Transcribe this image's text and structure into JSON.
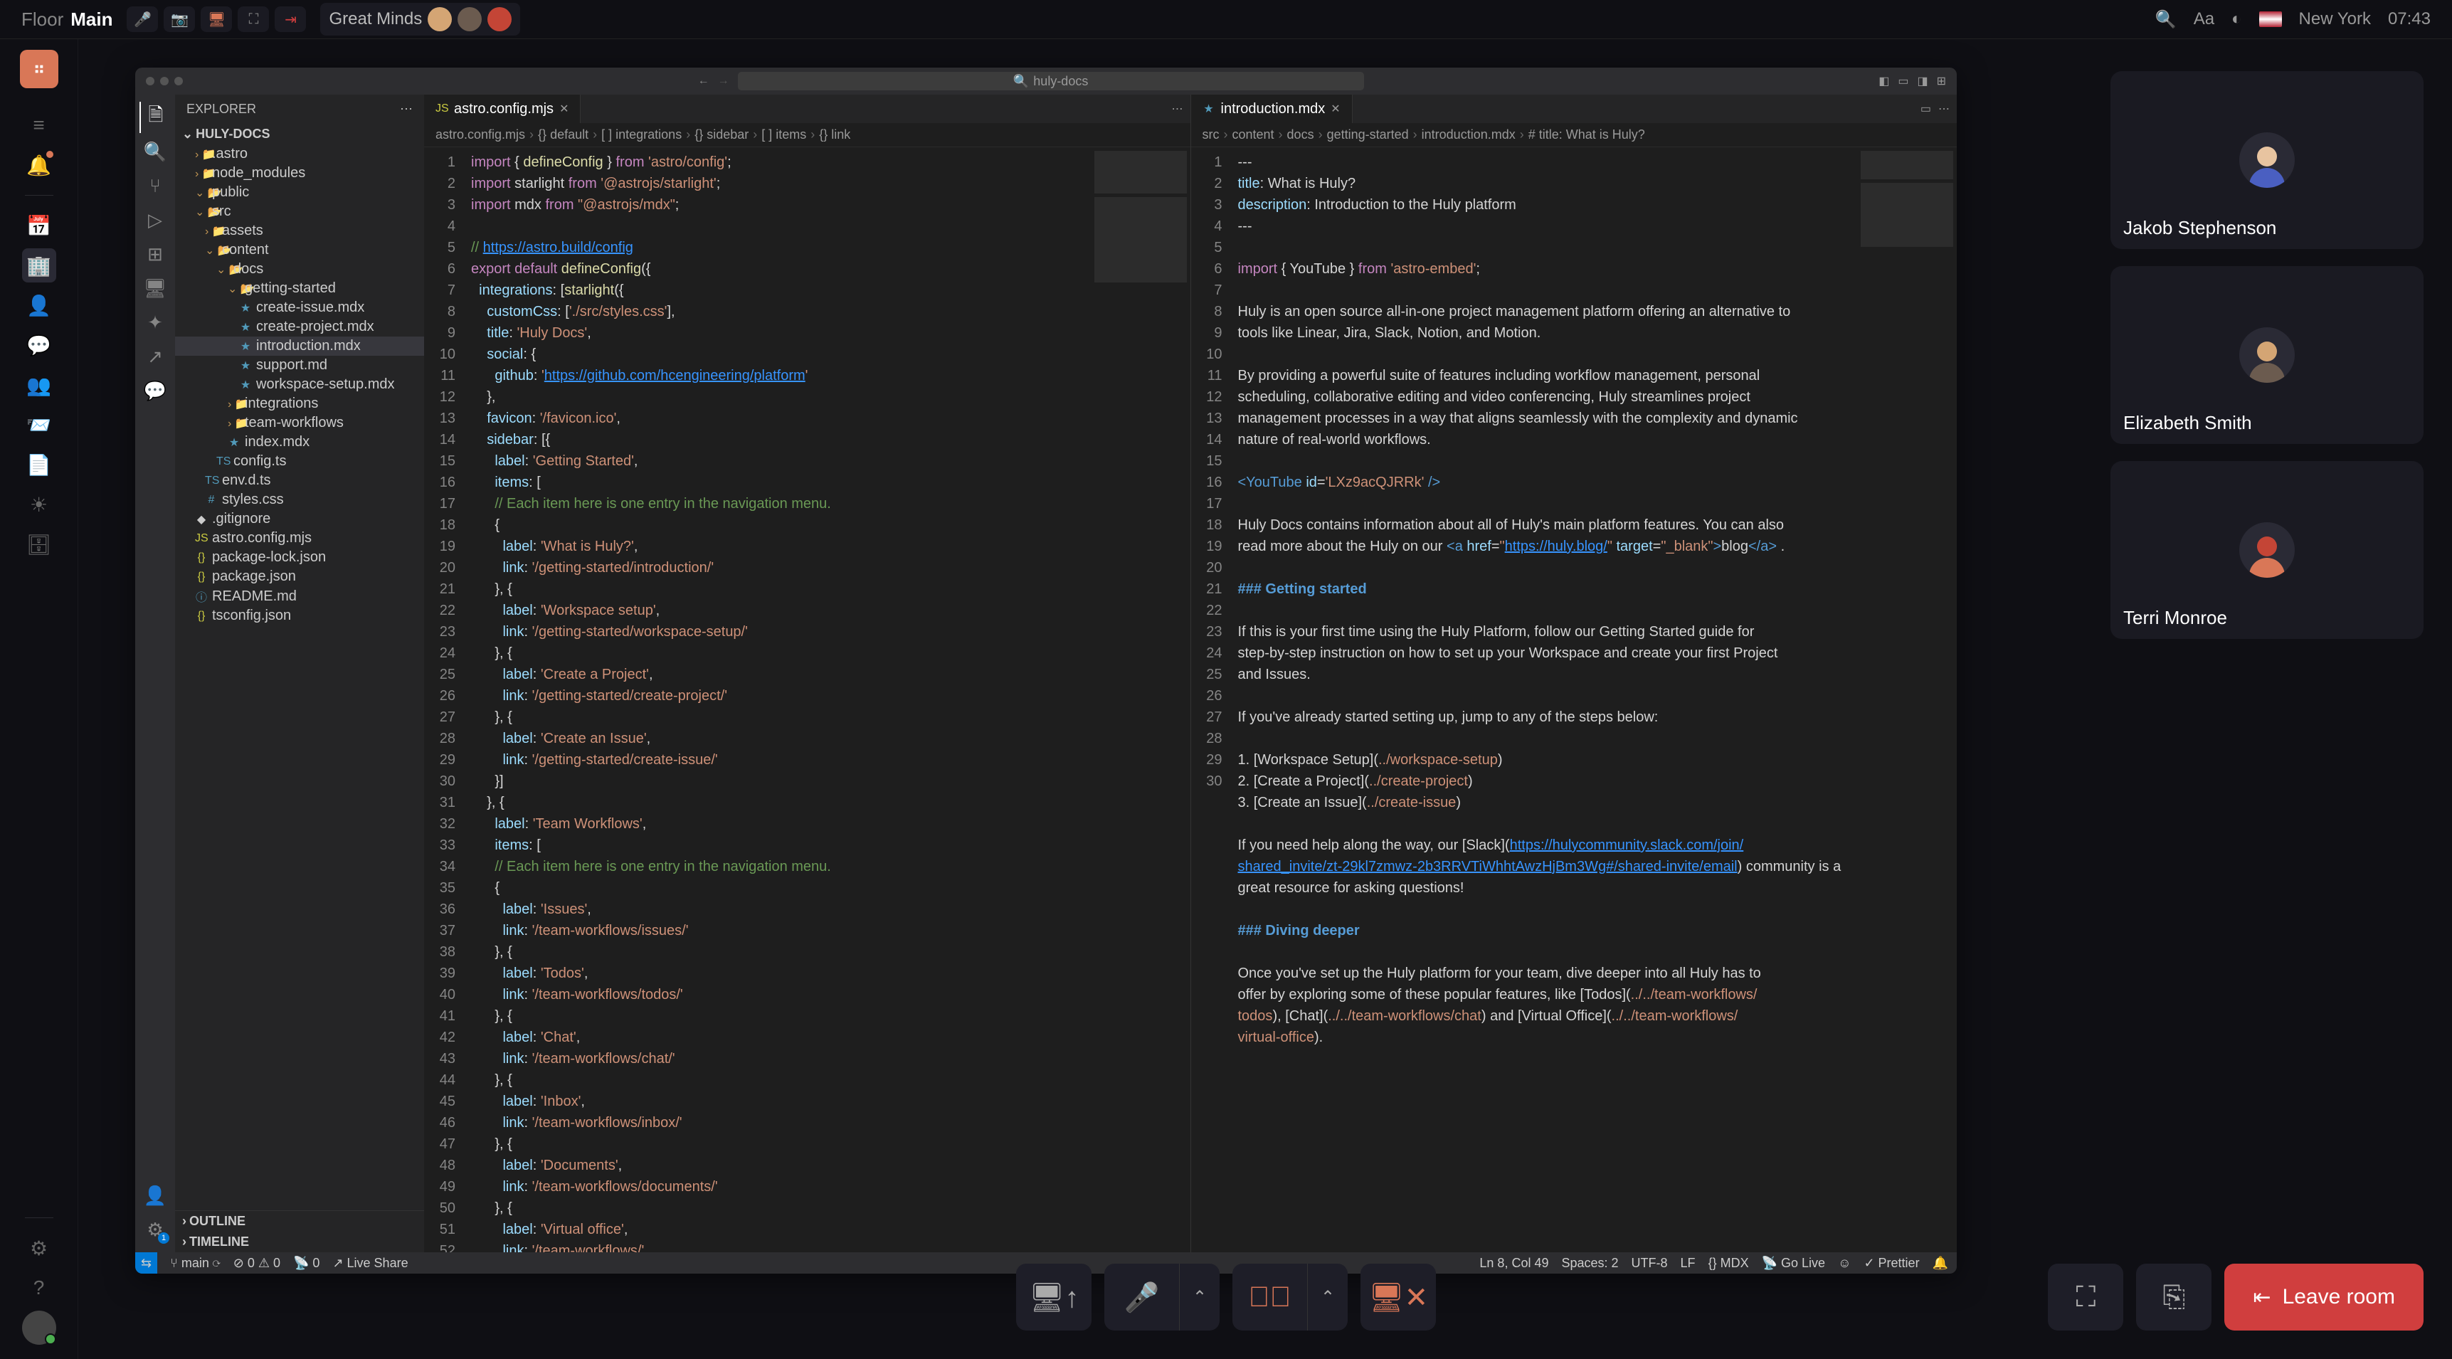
{
  "topbar": {
    "floor": "Floor",
    "room": "Main",
    "minds": "Great Minds",
    "location": "New York",
    "time": "07:43",
    "font_btn": "Aa"
  },
  "sidebar": {
    "items": [
      "menu",
      "notifications",
      "separator",
      "calendar",
      "office",
      "people-outline",
      "chat",
      "team",
      "feedback",
      "documents",
      "ideas",
      "database"
    ]
  },
  "vscode": {
    "search_placeholder": "huly-docs",
    "explorer_title": "EXPLORER",
    "project": "HULY-DOCS",
    "outline": "OUTLINE",
    "timeline": "TIMELINE",
    "tree": [
      {
        "d": 0,
        "t": "folder-closed",
        "n": ".astro"
      },
      {
        "d": 0,
        "t": "folder-closed",
        "n": "node_modules"
      },
      {
        "d": 0,
        "t": "folder-open",
        "n": "public"
      },
      {
        "d": 0,
        "t": "folder-open",
        "n": "src"
      },
      {
        "d": 1,
        "t": "folder-closed",
        "n": "assets"
      },
      {
        "d": 1,
        "t": "folder-open",
        "n": "content"
      },
      {
        "d": 2,
        "t": "folder-open",
        "n": "docs"
      },
      {
        "d": 3,
        "t": "folder-open",
        "n": "getting-started"
      },
      {
        "d": 4,
        "t": "md",
        "n": "create-issue.mdx"
      },
      {
        "d": 4,
        "t": "md",
        "n": "create-project.mdx"
      },
      {
        "d": 4,
        "t": "md",
        "n": "introduction.mdx",
        "sel": true
      },
      {
        "d": 4,
        "t": "md",
        "n": "support.md"
      },
      {
        "d": 4,
        "t": "md",
        "n": "workspace-setup.mdx"
      },
      {
        "d": 3,
        "t": "folder-closed",
        "n": "integrations"
      },
      {
        "d": 3,
        "t": "folder-closed",
        "n": "team-workflows"
      },
      {
        "d": 3,
        "t": "md",
        "n": "index.mdx"
      },
      {
        "d": 2,
        "t": "ts",
        "n": "config.ts"
      },
      {
        "d": 1,
        "t": "ts",
        "n": "env.d.ts"
      },
      {
        "d": 1,
        "t": "css",
        "n": "styles.css"
      },
      {
        "d": 0,
        "t": "git",
        "n": ".gitignore"
      },
      {
        "d": 0,
        "t": "js",
        "n": "astro.config.mjs"
      },
      {
        "d": 0,
        "t": "json",
        "n": "package-lock.json"
      },
      {
        "d": 0,
        "t": "json",
        "n": "package.json"
      },
      {
        "d": 0,
        "t": "readme",
        "n": "README.md"
      },
      {
        "d": 0,
        "t": "json",
        "n": "tsconfig.json"
      }
    ],
    "left_tab": "astro.config.mjs",
    "left_breadcrumb": [
      "astro.config.mjs",
      "{} default",
      "[ ] integrations",
      "{} sidebar",
      "[ ] items",
      "{} link"
    ],
    "right_tab": "introduction.mdx",
    "right_breadcrumb": [
      "src",
      "content",
      "docs",
      "getting-started",
      "introduction.mdx",
      "# title: What is Huly?"
    ],
    "status": {
      "branch": "main",
      "errors": "0",
      "warnings": "0",
      "ports": "0",
      "live_share": "Live Share",
      "position": "Ln 8, Col 49",
      "spaces": "Spaces: 2",
      "encoding": "UTF-8",
      "eol": "LF",
      "lang": "MDX",
      "golive": "Go Live",
      "prettier": "Prettier"
    }
  },
  "participants": [
    {
      "name": "Jakob Stephenson",
      "head": "#e8c4a0",
      "body": "#4a5fc1"
    },
    {
      "name": "Elizabeth Smith",
      "head": "#d4a574",
      "body": "#6b5b4f"
    },
    {
      "name": "Terri Monroe",
      "head": "#e8c4a0",
      "body": "#d97757",
      "hair": "#c44536"
    }
  ],
  "call": {
    "leave": "Leave room"
  }
}
